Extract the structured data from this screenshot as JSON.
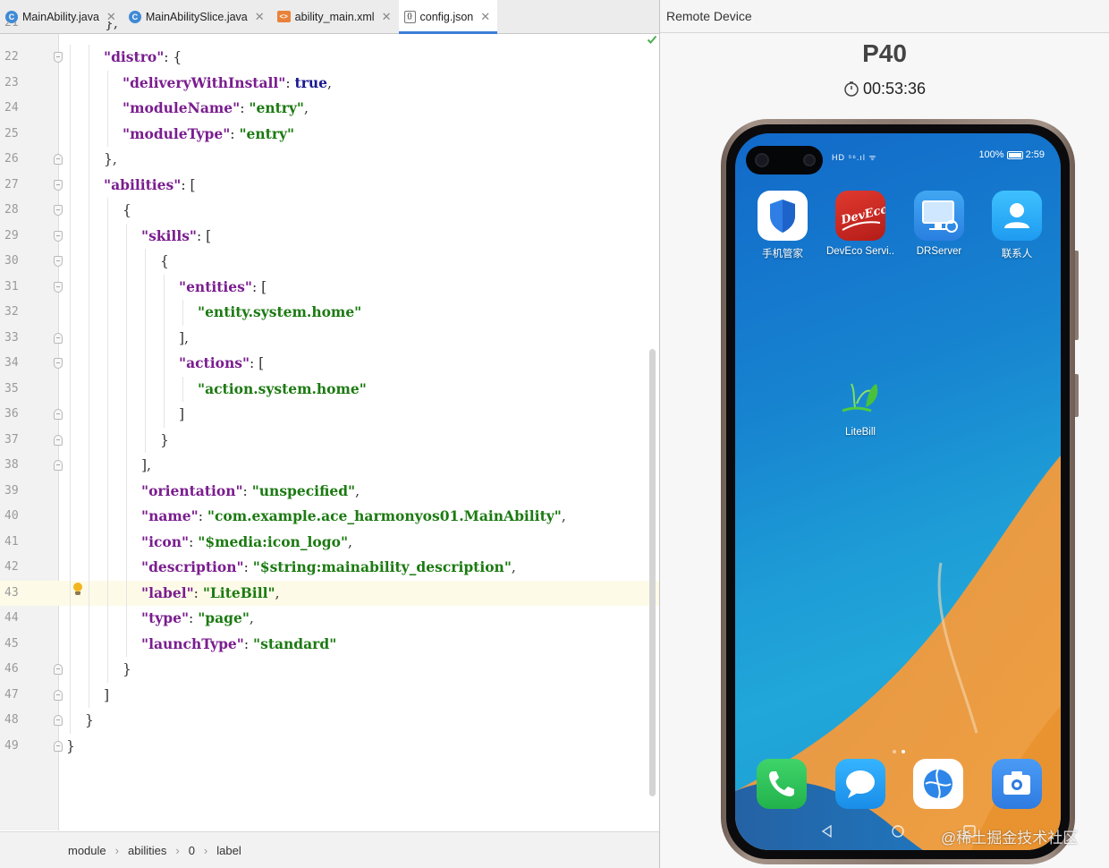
{
  "editor": {
    "tabs": [
      {
        "label": "MainAbility.java",
        "icon": "java-class-icon",
        "active": false
      },
      {
        "label": "MainAbilitySlice.java",
        "icon": "java-class-icon",
        "active": false
      },
      {
        "label": "ability_main.xml",
        "icon": "xml-file-icon",
        "active": false
      },
      {
        "label": "config.json",
        "icon": "json-file-icon",
        "active": true
      }
    ],
    "current_line": 43,
    "lines": [
      {
        "n": "22",
        "fold": "open",
        "indent": 2,
        "tokens": [
          [
            "key",
            "\"distro\""
          ],
          [
            "p",
            ": {"
          ]
        ]
      },
      {
        "n": "23",
        "fold": "",
        "indent": 3,
        "tokens": [
          [
            "key",
            "\"deliveryWithInstall\""
          ],
          [
            "p",
            ": "
          ],
          [
            "kw",
            "true"
          ],
          [
            "p",
            ","
          ]
        ]
      },
      {
        "n": "24",
        "fold": "",
        "indent": 3,
        "tokens": [
          [
            "key",
            "\"moduleName\""
          ],
          [
            "p",
            ": "
          ],
          [
            "str",
            "\"entry\""
          ],
          [
            "p",
            ","
          ]
        ]
      },
      {
        "n": "25",
        "fold": "",
        "indent": 3,
        "tokens": [
          [
            "key",
            "\"moduleType\""
          ],
          [
            "p",
            ": "
          ],
          [
            "str",
            "\"entry\""
          ]
        ]
      },
      {
        "n": "26",
        "fold": "close",
        "indent": 2,
        "tokens": [
          [
            "p",
            "},"
          ]
        ]
      },
      {
        "n": "27",
        "fold": "open",
        "indent": 2,
        "tokens": [
          [
            "key",
            "\"abilities\""
          ],
          [
            "p",
            ": ["
          ]
        ]
      },
      {
        "n": "28",
        "fold": "open",
        "indent": 3,
        "tokens": [
          [
            "p",
            "{"
          ]
        ]
      },
      {
        "n": "29",
        "fold": "open",
        "indent": 4,
        "tokens": [
          [
            "key",
            "\"skills\""
          ],
          [
            "p",
            ": ["
          ]
        ]
      },
      {
        "n": "30",
        "fold": "open",
        "indent": 5,
        "tokens": [
          [
            "p",
            "{"
          ]
        ]
      },
      {
        "n": "31",
        "fold": "open",
        "indent": 6,
        "tokens": [
          [
            "key",
            "\"entities\""
          ],
          [
            "p",
            ": ["
          ]
        ]
      },
      {
        "n": "32",
        "fold": "",
        "indent": 7,
        "tokens": [
          [
            "str",
            "\"entity.system.home\""
          ]
        ]
      },
      {
        "n": "33",
        "fold": "close",
        "indent": 6,
        "tokens": [
          [
            "p",
            "],"
          ]
        ]
      },
      {
        "n": "34",
        "fold": "open",
        "indent": 6,
        "tokens": [
          [
            "key",
            "\"actions\""
          ],
          [
            "p",
            ": ["
          ]
        ]
      },
      {
        "n": "35",
        "fold": "",
        "indent": 7,
        "tokens": [
          [
            "str",
            "\"action.system.home\""
          ]
        ]
      },
      {
        "n": "36",
        "fold": "close",
        "indent": 6,
        "tokens": [
          [
            "p",
            "]"
          ]
        ]
      },
      {
        "n": "37",
        "fold": "close",
        "indent": 5,
        "tokens": [
          [
            "p",
            "}"
          ]
        ]
      },
      {
        "n": "38",
        "fold": "close",
        "indent": 4,
        "tokens": [
          [
            "p",
            "],"
          ]
        ]
      },
      {
        "n": "39",
        "fold": "",
        "indent": 4,
        "tokens": [
          [
            "key",
            "\"orientation\""
          ],
          [
            "p",
            ": "
          ],
          [
            "str",
            "\"unspecified\""
          ],
          [
            "p",
            ","
          ]
        ]
      },
      {
        "n": "40",
        "fold": "",
        "indent": 4,
        "tokens": [
          [
            "key",
            "\"name\""
          ],
          [
            "p",
            ": "
          ],
          [
            "str",
            "\"com.example.ace_harmonyos01.MainAbility\""
          ],
          [
            "p",
            ","
          ]
        ]
      },
      {
        "n": "41",
        "fold": "",
        "indent": 4,
        "tokens": [
          [
            "key",
            "\"icon\""
          ],
          [
            "p",
            ": "
          ],
          [
            "str",
            "\"$media:icon_logo\""
          ],
          [
            "p",
            ","
          ]
        ]
      },
      {
        "n": "42",
        "fold": "",
        "indent": 4,
        "tokens": [
          [
            "key",
            "\"description\""
          ],
          [
            "p",
            ": "
          ],
          [
            "str",
            "\"$string:mainability_description\""
          ],
          [
            "p",
            ","
          ]
        ]
      },
      {
        "n": "43",
        "fold": "",
        "indent": 4,
        "tokens": [
          [
            "key",
            "\"label\""
          ],
          [
            "p",
            ": "
          ],
          [
            "str",
            "\"LiteBill\""
          ],
          [
            "p",
            ","
          ]
        ]
      },
      {
        "n": "44",
        "fold": "",
        "indent": 4,
        "tokens": [
          [
            "key",
            "\"type\""
          ],
          [
            "p",
            ": "
          ],
          [
            "str",
            "\"page\""
          ],
          [
            "p",
            ","
          ]
        ]
      },
      {
        "n": "45",
        "fold": "",
        "indent": 4,
        "tokens": [
          [
            "key",
            "\"launchType\""
          ],
          [
            "p",
            ": "
          ],
          [
            "str",
            "\"standard\""
          ]
        ]
      },
      {
        "n": "46",
        "fold": "close",
        "indent": 3,
        "tokens": [
          [
            "p",
            "}"
          ]
        ]
      },
      {
        "n": "47",
        "fold": "close",
        "indent": 2,
        "tokens": [
          [
            "p",
            "]"
          ]
        ]
      },
      {
        "n": "48",
        "fold": "close",
        "indent": 1,
        "tokens": [
          [
            "p",
            "}"
          ]
        ]
      },
      {
        "n": "49",
        "fold": "close",
        "indent": 0,
        "tokens": [
          [
            "p",
            "}"
          ]
        ]
      }
    ],
    "colors": {
      "key": "#7a1d8f",
      "string": "#1c7a12",
      "keyword": "#1a1a8f",
      "current_line_bg": "#fdfbe8",
      "active_tab_underline": "#3d7dd8"
    },
    "breadcrumb": [
      "module",
      "abilities",
      "0",
      "label"
    ]
  },
  "remote_device": {
    "panel_title": "Remote Device",
    "device_name": "P40",
    "timer": "00:53:36",
    "status_bar": {
      "left": "HD ⁵⁶.ıl ᯤ",
      "battery": "100%",
      "time": "2:59"
    },
    "apps": [
      {
        "label": "手机管家",
        "icon": "phone-manager-shield-icon"
      },
      {
        "label": "DevEco Servi..",
        "icon": "deveco-service-icon"
      },
      {
        "label": "DRServer",
        "icon": "drserver-monitor-icon"
      },
      {
        "label": "联系人",
        "icon": "contacts-icon"
      },
      {
        "label": "LiteBill",
        "icon": "litebill-bird-icon"
      }
    ],
    "dock": [
      {
        "name": "phone",
        "icon": "phone-call-icon"
      },
      {
        "name": "messages",
        "icon": "messages-icon"
      },
      {
        "name": "browser",
        "icon": "browser-icon"
      },
      {
        "name": "camera",
        "icon": "camera-icon"
      }
    ],
    "watermark": "@稀土掘金技术社区"
  }
}
